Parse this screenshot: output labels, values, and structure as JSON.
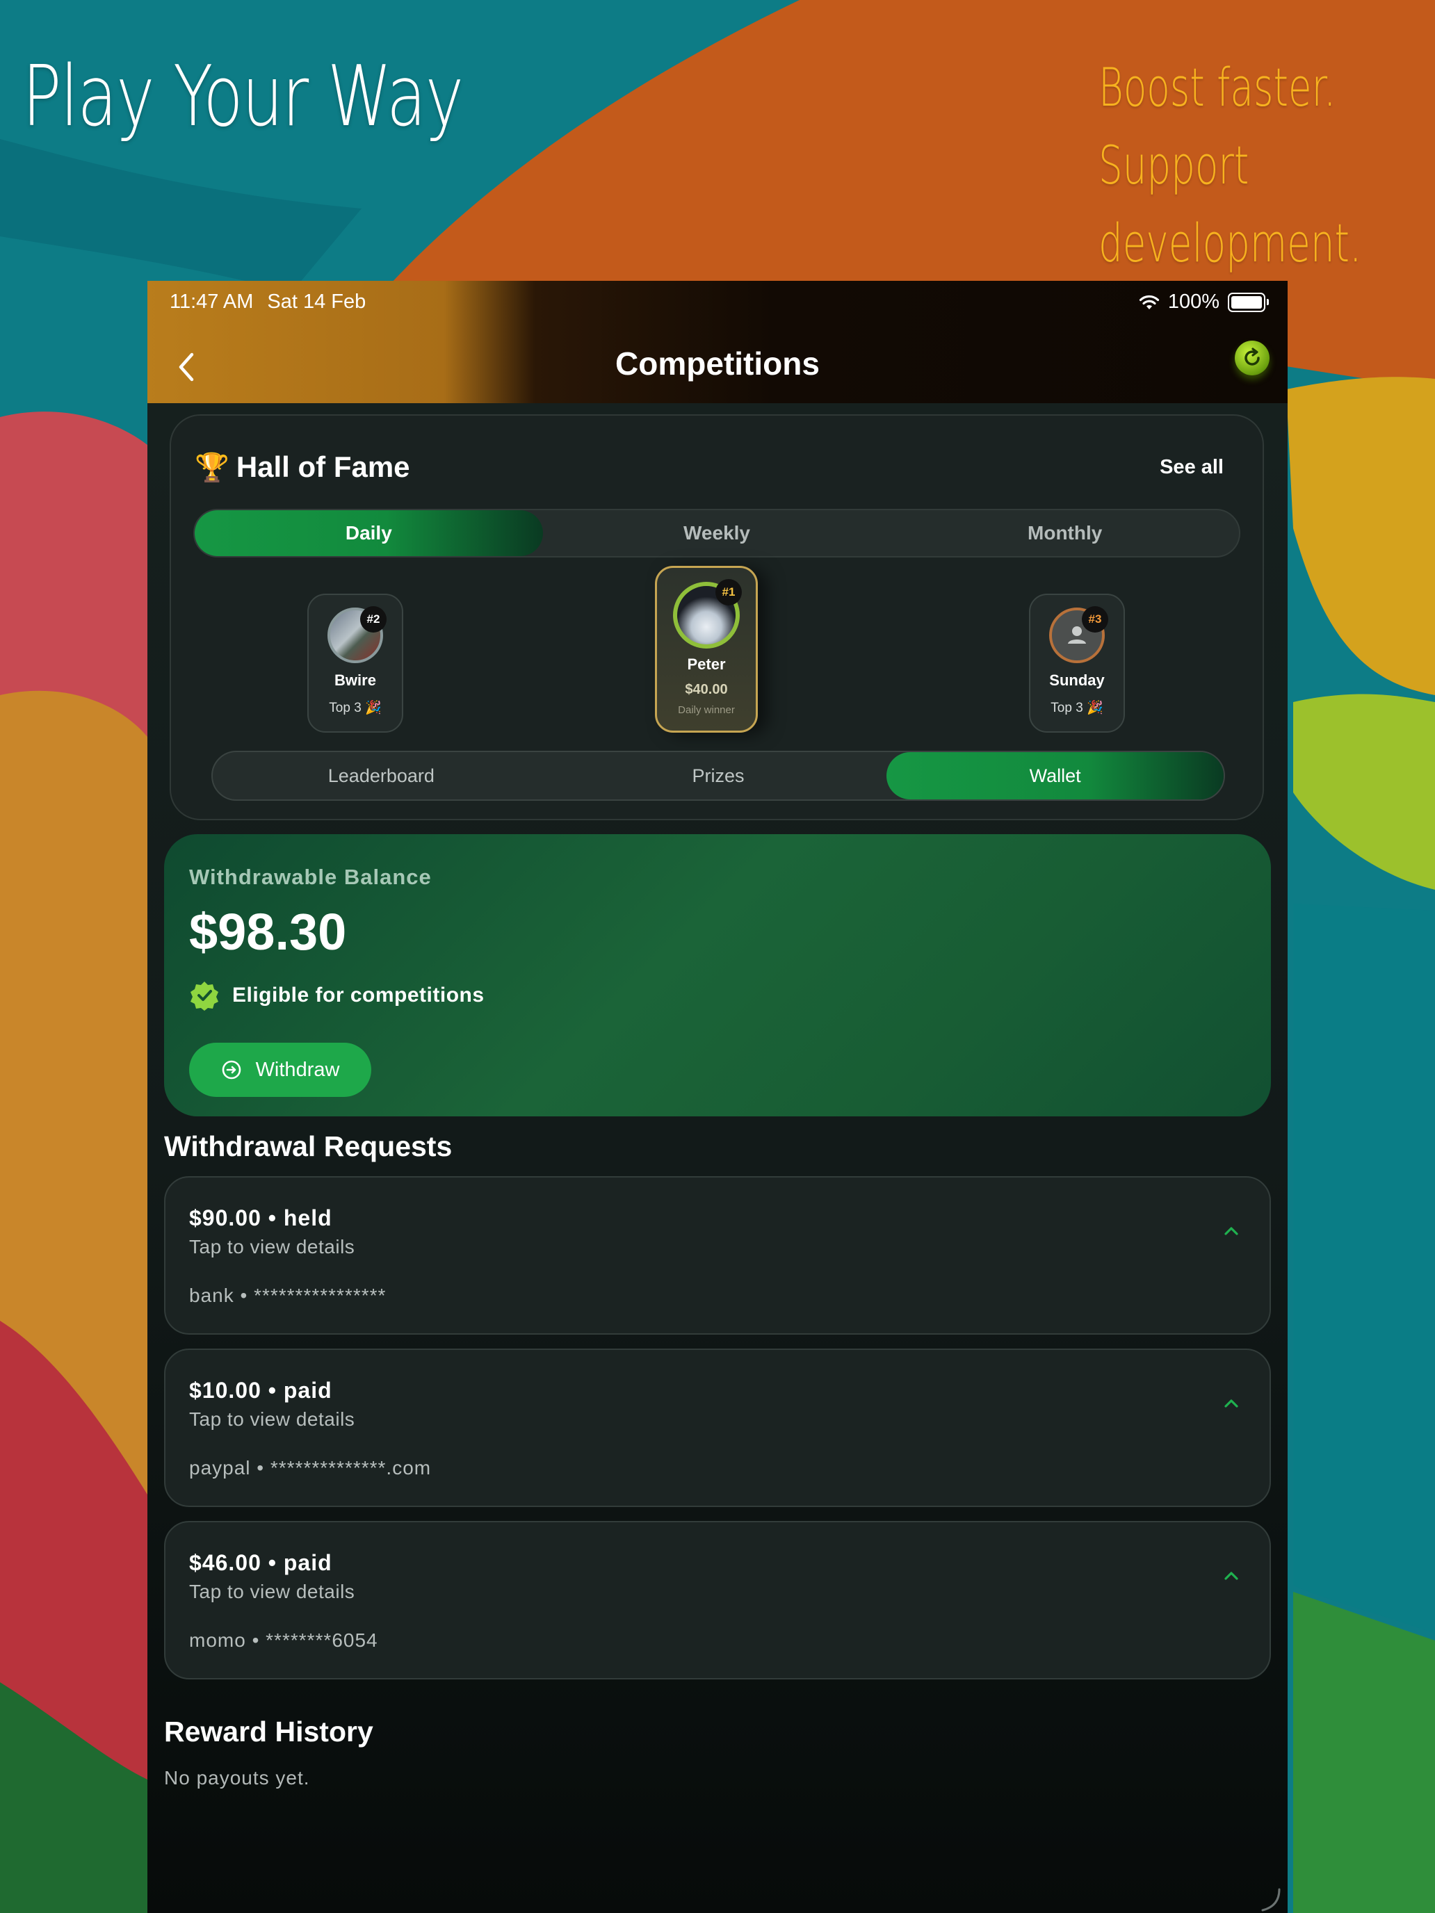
{
  "promo": {
    "left_title": "Play Your Way",
    "right_lines": [
      "Boost faster.",
      "Support",
      "development."
    ]
  },
  "status_bar": {
    "time": "11:47 AM",
    "date": "Sat 14 Feb",
    "battery": "100%",
    "wifi_icon": "wifi-icon",
    "battery_icon": "battery-icon"
  },
  "nav": {
    "back_icon": "chevron-left-icon",
    "title": "Competitions",
    "refresh_icon": "refresh-icon"
  },
  "hall_of_fame": {
    "icon": "trophy-icon",
    "title": "Hall of Fame",
    "see_all": "See all",
    "period_tabs": [
      {
        "label": "Daily",
        "active": true
      },
      {
        "label": "Weekly",
        "active": false
      },
      {
        "label": "Monthly",
        "active": false
      }
    ],
    "podium": {
      "first": {
        "rank": "#1",
        "name": "Peter",
        "amount": "$40.00",
        "caption": "Daily winner"
      },
      "second": {
        "rank": "#2",
        "name": "Bwire",
        "caption": "Top 3 🎉"
      },
      "third": {
        "rank": "#3",
        "name": "Sunday",
        "caption": "Top 3 🎉"
      }
    },
    "section_tabs": [
      {
        "label": "Leaderboard",
        "active": false
      },
      {
        "label": "Prizes",
        "active": false
      },
      {
        "label": "Wallet",
        "active": true
      }
    ]
  },
  "wallet": {
    "balance_label": "Withdrawable Balance",
    "balance_amount": "$98.30",
    "eligibility": "Eligible for competitions",
    "withdraw_label": "Withdraw",
    "accent_color": "#1ea84a"
  },
  "withdrawal_requests": {
    "heading": "Withdrawal Requests",
    "items": [
      {
        "title": "$90.00 • held",
        "subtitle": "Tap to view details",
        "method": "bank • ****************"
      },
      {
        "title": "$10.00 • paid",
        "subtitle": "Tap to view details",
        "method": "paypal • **************.com"
      },
      {
        "title": "$46.00 • paid",
        "subtitle": "Tap to view details",
        "method": "momo • ********6054"
      }
    ]
  },
  "reward_history": {
    "heading": "Reward History",
    "empty_text": "No payouts yet."
  }
}
